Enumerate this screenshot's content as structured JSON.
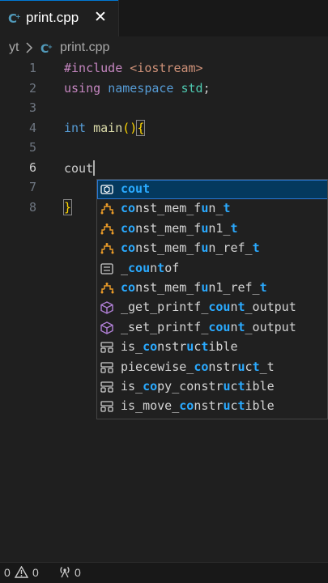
{
  "tab": {
    "filename": "print.cpp",
    "close_glyph": "✕"
  },
  "breadcrumb": {
    "folder": "yt",
    "file": "print.cpp"
  },
  "editor": {
    "line_numbers": [
      "1",
      "2",
      "3",
      "4",
      "5",
      "6",
      "7",
      "8"
    ],
    "active_line": "6",
    "lines": [
      {
        "tokens": [
          {
            "t": "#include",
            "c": "kw-purple"
          },
          {
            "t": " ",
            "c": "plain"
          },
          {
            "t": "<iostream>",
            "c": "str-orange"
          }
        ]
      },
      {
        "tokens": [
          {
            "t": "using",
            "c": "kw-purple"
          },
          {
            "t": " ",
            "c": "plain"
          },
          {
            "t": "namespace",
            "c": "kw-blue"
          },
          {
            "t": " ",
            "c": "plain"
          },
          {
            "t": "std",
            "c": "ident"
          },
          {
            "t": ";",
            "c": "plain"
          }
        ]
      },
      {
        "tokens": []
      },
      {
        "tokens": [
          {
            "t": "int",
            "c": "kw-blue"
          },
          {
            "t": " ",
            "c": "plain"
          },
          {
            "t": "main",
            "c": "fn"
          },
          {
            "t": "()",
            "c": "brace"
          },
          {
            "t": "{",
            "c": "brace bracket-box"
          }
        ]
      },
      {
        "tokens": []
      },
      {
        "tokens": [
          {
            "t": "cout",
            "c": "plain"
          }
        ],
        "cursor": true
      },
      {
        "tokens": []
      },
      {
        "tokens": [
          {
            "t": "}",
            "c": "brace bracket-box"
          }
        ]
      }
    ]
  },
  "suggestions": [
    {
      "kind": "variable-icon",
      "parts": [
        [
          "cout",
          true
        ]
      ],
      "selected": true
    },
    {
      "kind": "struct-icon",
      "parts": [
        [
          "co",
          true
        ],
        [
          "nst_mem_f",
          false
        ],
        [
          "u",
          true
        ],
        [
          "n_",
          false
        ],
        [
          "t",
          true
        ]
      ]
    },
    {
      "kind": "struct-icon",
      "parts": [
        [
          "co",
          true
        ],
        [
          "nst_mem_f",
          false
        ],
        [
          "u",
          true
        ],
        [
          "n1_",
          false
        ],
        [
          "t",
          true
        ]
      ]
    },
    {
      "kind": "struct-icon",
      "parts": [
        [
          "co",
          true
        ],
        [
          "nst_mem_f",
          false
        ],
        [
          "u",
          true
        ],
        [
          "n_ref_",
          false
        ],
        [
          "t",
          true
        ]
      ]
    },
    {
      "kind": "keyword-icon",
      "parts": [
        [
          "_",
          false
        ],
        [
          "cou",
          true
        ],
        [
          "n",
          false
        ],
        [
          "t",
          true
        ],
        [
          "of",
          false
        ]
      ]
    },
    {
      "kind": "struct-icon",
      "parts": [
        [
          "co",
          true
        ],
        [
          "nst_mem_f",
          false
        ],
        [
          "u",
          true
        ],
        [
          "n1_ref_",
          false
        ],
        [
          "t",
          true
        ]
      ]
    },
    {
      "kind": "method-icon",
      "parts": [
        [
          "_get_printf_",
          false
        ],
        [
          "cou",
          true
        ],
        [
          "n",
          false
        ],
        [
          "t",
          true
        ],
        [
          "_output",
          false
        ]
      ]
    },
    {
      "kind": "method-icon",
      "parts": [
        [
          "_set_printf_",
          false
        ],
        [
          "cou",
          true
        ],
        [
          "n",
          false
        ],
        [
          "t",
          true
        ],
        [
          "_output",
          false
        ]
      ]
    },
    {
      "kind": "template-icon",
      "parts": [
        [
          "is_",
          false
        ],
        [
          "co",
          true
        ],
        [
          "nstr",
          false
        ],
        [
          "u",
          true
        ],
        [
          "c",
          false
        ],
        [
          "t",
          true
        ],
        [
          "ible",
          false
        ]
      ]
    },
    {
      "kind": "template-icon",
      "parts": [
        [
          "piecewise_",
          false
        ],
        [
          "co",
          true
        ],
        [
          "nstr",
          false
        ],
        [
          "u",
          true
        ],
        [
          "c",
          false
        ],
        [
          "t",
          true
        ],
        [
          "_t",
          false
        ]
      ]
    },
    {
      "kind": "template-icon",
      "parts": [
        [
          "is_",
          false
        ],
        [
          "co",
          true
        ],
        [
          "py_constr",
          false
        ],
        [
          "u",
          true
        ],
        [
          "c",
          false
        ],
        [
          "t",
          true
        ],
        [
          "ible",
          false
        ]
      ]
    },
    {
      "kind": "template-icon",
      "parts": [
        [
          "is_move_",
          false
        ],
        [
          "co",
          true
        ],
        [
          "nstr",
          false
        ],
        [
          "u",
          true
        ],
        [
          "c",
          false
        ],
        [
          "t",
          true
        ],
        [
          "ible",
          false
        ]
      ]
    }
  ],
  "status": {
    "errors": "0",
    "warnings": "0",
    "ports": "0"
  },
  "colors": {
    "accent": "#0078d4",
    "match": "#2aaaff",
    "selected_bg": "#04395e"
  }
}
